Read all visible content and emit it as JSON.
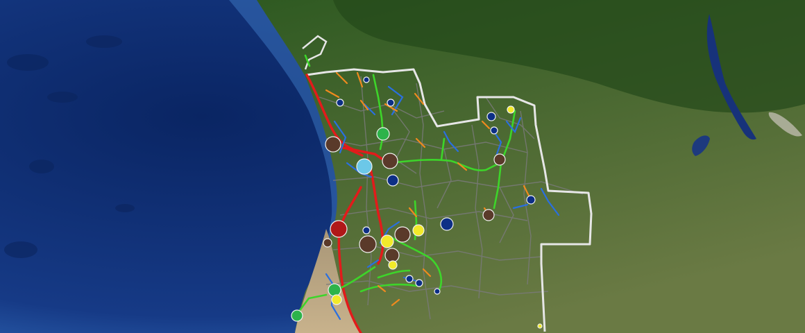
{
  "map": {
    "view": "satellite",
    "colors": {
      "ocean_deep": "#0a2563",
      "ocean_mid": "#163a86",
      "ocean_shelf": "#2f66b4",
      "land_forest": "#2f5a22",
      "land_savanna": "#56703a",
      "land_desert": "#b9a482",
      "lake": "#17327a",
      "border_outer": "#e6e6e6",
      "border_internal": "#7a7a7a",
      "route_primary": "#e21b1b",
      "route_secondary": "#3dd52a",
      "route_tertiary": "#2a6fe0",
      "route_feeder": "#f08a1e",
      "marker_brown": "#5a3a2a",
      "marker_green": "#2db34a",
      "marker_yellow": "#f2ea2a",
      "marker_navy": "#0d2f86",
      "marker_red": "#b01818",
      "marker_cyan": "#6cc8e8"
    }
  }
}
